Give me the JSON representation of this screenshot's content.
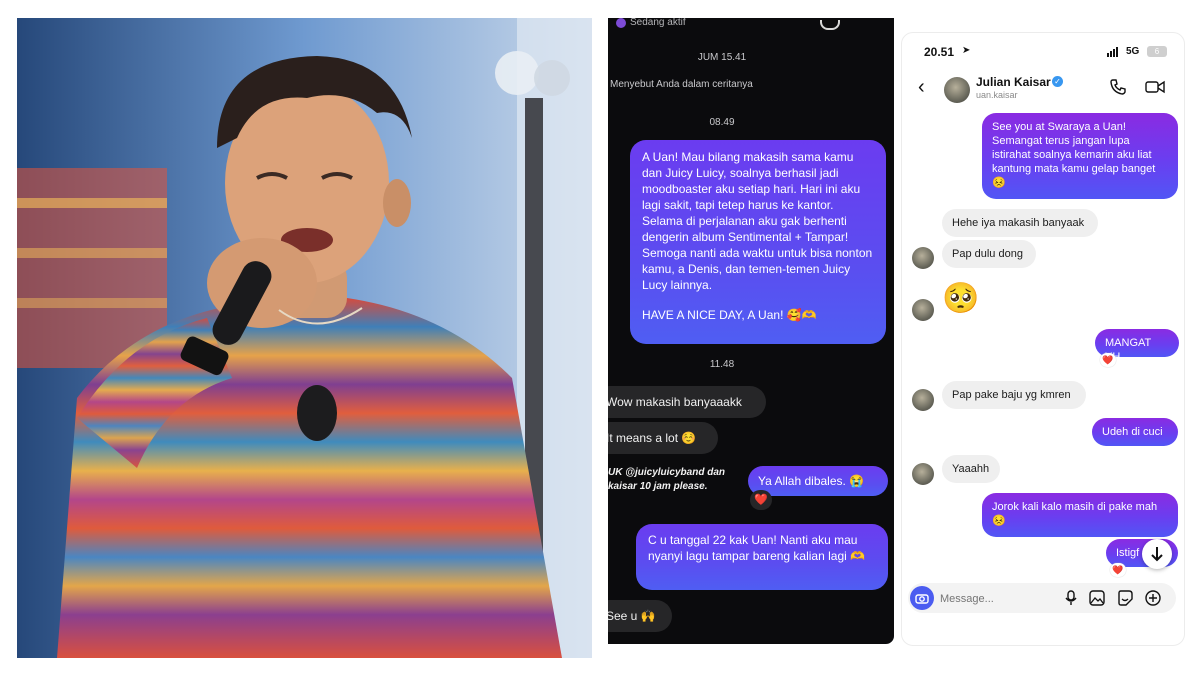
{
  "dark_chat": {
    "status": "Sedang aktif",
    "time_fri": "JUM 15.41",
    "mention": "Menyebut Anda dalam ceritanya",
    "time_1": "08.49",
    "fan_message": "A Uan! Mau bilang makasih sama kamu dan Juicy Luicy, soalnya berhasil jadi moodboaster aku setiap hari. Hari ini aku lagi sakit, tapi tetep harus ke kantor. Selama di perjalanan aku gak berhenti dengerin album Sentimental + Tampar! Semoga nanti ada waktu untuk bisa nonton kamu, a Denis, dan temen-temen Juicy Lucy lainnya.",
    "fan_signoff": "HAVE A NICE DAY, A Uan! 🥰🫶",
    "time_2": "11.48",
    "reply_1": "Wow makasih banyaaakk",
    "reply_2": "It means a lot ☺️",
    "story_caption": "UK @juicyluicyband dan kaisar 10 jam please.",
    "story_reply": "Ya Allah dibales. 😭",
    "story_reaction": "❤️",
    "fan_message_2": "C u tanggal 22 kak Uan! Nanti aku mau nyanyi lagu tampar bareng kalian lagi 🫶",
    "reply_3": "See u 🙌"
  },
  "light_chat": {
    "status_bar": {
      "time": "20.51",
      "network": "5G",
      "battery": "6"
    },
    "header": {
      "name": "Julian Kaisar",
      "handle": "uan.kaisar"
    },
    "messages": {
      "m1": "See you at Swaraya a Uan! Semangat terus jangan lupa istirahat soalnya kemarin aku liat kantung mata kamu gelap banget 😣",
      "m2": "Hehe iya makasih banyaak",
      "m3": "Pap dulu dong",
      "m4": "🥺",
      "m5": "MANGAT YH",
      "m6": "Pap pake baju yg kmren",
      "m7": "Udeh di cuci",
      "m8": "Yaaahh",
      "m9": "Jorok kali kalo masih di pake mah 😣",
      "m10": "Istigf",
      "reaction": "❤️"
    },
    "composer": {
      "placeholder": "Message..."
    }
  },
  "colors": {
    "dark_bg": "#0b0b0d",
    "purple": "#6b3cf0",
    "blue_purple": "#4f5ef3",
    "verified": "#3897f0"
  },
  "icons": [
    "back-icon",
    "verified-icon",
    "phone-icon",
    "video-icon",
    "camera-icon",
    "mic-icon",
    "gallery-icon",
    "sticker-icon",
    "plus-icon",
    "scroll-down-icon",
    "location-arrow-icon",
    "signal-icon"
  ]
}
